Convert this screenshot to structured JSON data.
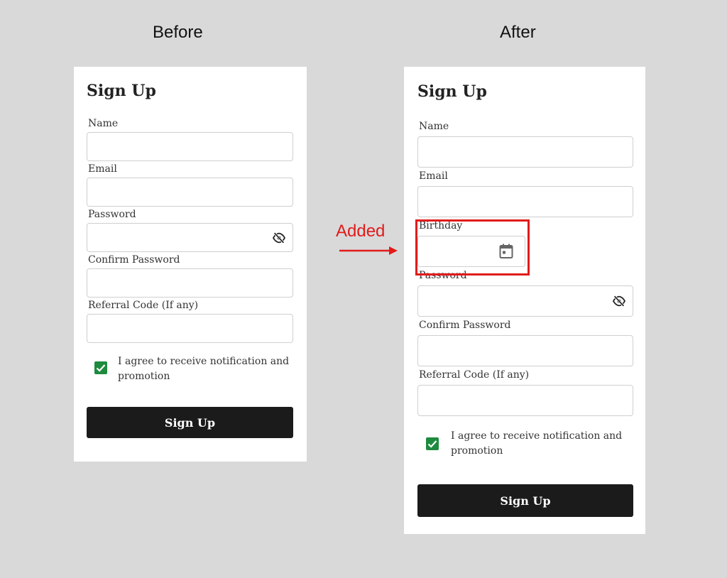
{
  "captions": {
    "before": "Before",
    "after": "After"
  },
  "annotation": {
    "label": "Added",
    "color": "#e21b1b"
  },
  "accent_color": "#1e8a3e",
  "button_color": "#1c1b1c",
  "before": {
    "title": "Sign Up",
    "fields": {
      "name": {
        "label": "Name",
        "value": ""
      },
      "email": {
        "label": "Email",
        "value": ""
      },
      "password": {
        "label": "Password",
        "value": "",
        "icon": "eye-slash-icon"
      },
      "confirm_password": {
        "label": "Confirm Password",
        "value": ""
      },
      "referral": {
        "label": "Referral Code (If any)",
        "value": ""
      }
    },
    "consent": {
      "checked": true,
      "text": "I agree to receive notification and promotion"
    },
    "submit_label": "Sign Up"
  },
  "after": {
    "title": "Sign Up",
    "fields": {
      "name": {
        "label": "Name",
        "value": ""
      },
      "email": {
        "label": "Email",
        "value": ""
      },
      "birthday": {
        "label": "Birthday",
        "value": "",
        "icon": "calendar-icon"
      },
      "password": {
        "label": "Password",
        "value": "",
        "icon": "eye-slash-icon"
      },
      "confirm_password": {
        "label": "Confirm Password",
        "value": ""
      },
      "referral": {
        "label": "Referral Code (If any)",
        "value": ""
      }
    },
    "consent": {
      "checked": true,
      "text": "I agree to receive notification and promotion"
    },
    "submit_label": "Sign Up"
  }
}
